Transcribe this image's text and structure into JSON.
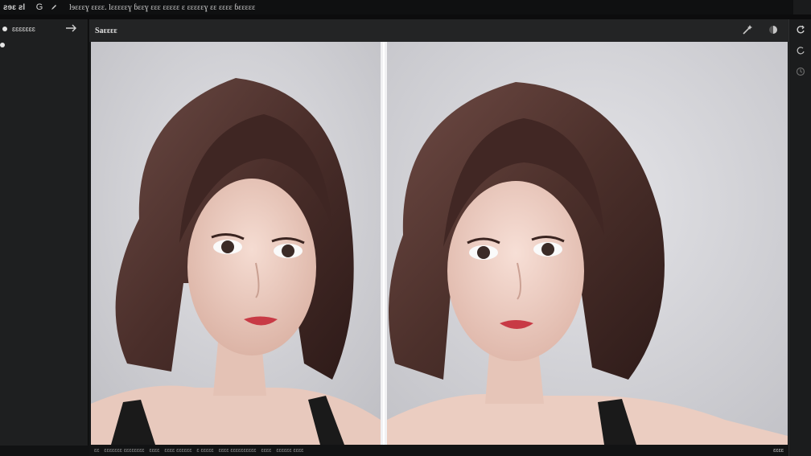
{
  "topbar": {
    "app_label": "ƨɘɛ ƨl",
    "menu_icon": "G",
    "pen_icon": "pen-icon",
    "document_title": "lɘɛɛɛɣ ɛɛɛɛ. lɛɛɛɛɛɣ ɓɛɛɣ ɛɛɛ ɛɛɛɛɛ ɛ ɛɛɛɛɛɣ ɛɛ ɛɛɛɛ ɓɛɛɛɛɛ"
  },
  "left_panel": {
    "layer_label": "ɛɛɛɛɛɛɛ",
    "split_icon": "split-icon"
  },
  "center": {
    "title": "Saɛɛɛɛ",
    "tools": [
      "wand-icon",
      "contrast-icon"
    ]
  },
  "right_panel": {
    "buttons": [
      "refresh-icon",
      "cycle-icon",
      "clock-icon"
    ]
  },
  "status_bar": {
    "items": [
      "ɛɛ",
      "ɛɛɛɛɛɛɛ ɛɛɛɛɛɛɛɛ",
      "ɛɛɛɛ",
      "ɛɛɛɛ ɛɛɛɛɛɛ",
      "ɛ ɛɛɛɛɛ",
      "ɛɛɛɛ ɛɛɛɛɛɛɛɛɛɛ",
      "ɛɛɛɛ",
      "ɛɛɛɛɛɛ ɛɛɛɛ"
    ],
    "page": "ɛɛɛɛ"
  },
  "colors": {
    "background": "#141516",
    "panel": "#1e1f20",
    "canvas_bg": "#d9d9dd",
    "hair": "#4a2e2a",
    "skin": "#efd2c7",
    "lips": "#c83a45"
  }
}
